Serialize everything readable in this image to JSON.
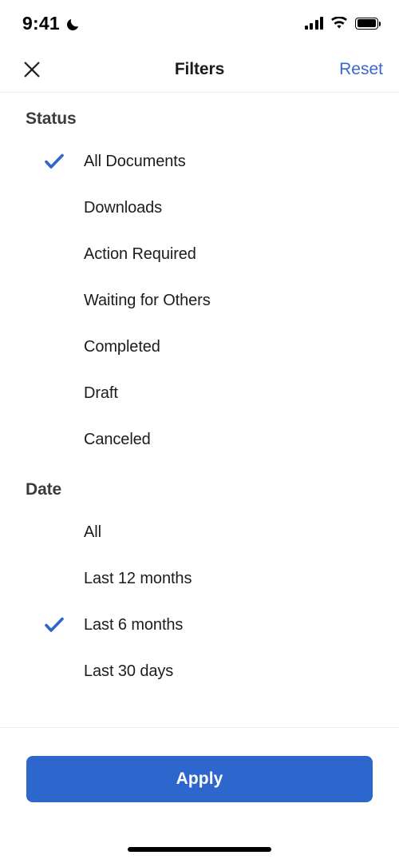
{
  "status_bar": {
    "time": "9:41",
    "dnd_icon": "crescent-moon-icon",
    "signal_icon": "cellular-signal-icon",
    "wifi_icon": "wifi-icon",
    "battery_icon": "battery-full-icon",
    "battery_level_percent": 100
  },
  "nav": {
    "close_icon": "close-x-icon",
    "title": "Filters",
    "reset_label": "Reset"
  },
  "overlay": {
    "tap_indicator": "touch-tap-indicator",
    "color": "#8c8c8e"
  },
  "sections": [
    {
      "id": "status",
      "header": "Status",
      "options": [
        {
          "label": "All Documents",
          "selected": true
        },
        {
          "label": "Downloads",
          "selected": false
        },
        {
          "label": "Action Required",
          "selected": false
        },
        {
          "label": "Waiting for Others",
          "selected": false
        },
        {
          "label": "Completed",
          "selected": false
        },
        {
          "label": "Draft",
          "selected": false
        },
        {
          "label": "Canceled",
          "selected": false
        }
      ]
    },
    {
      "id": "date",
      "header": "Date",
      "options": [
        {
          "label": "All",
          "selected": false
        },
        {
          "label": "Last 12 months",
          "selected": false
        },
        {
          "label": "Last 6 months",
          "selected": true
        },
        {
          "label": "Last 30 days",
          "selected": false
        }
      ]
    }
  ],
  "footer": {
    "apply_label": "Apply",
    "home_indicator": "home-indicator"
  },
  "colors": {
    "accent_blue": "#2d66cc",
    "check_blue": "#2d66cc",
    "link_blue": "#3a66d4",
    "text_primary": "#1c1c1e",
    "header_gray": "#3c3c3e",
    "divider": "#ececec"
  }
}
